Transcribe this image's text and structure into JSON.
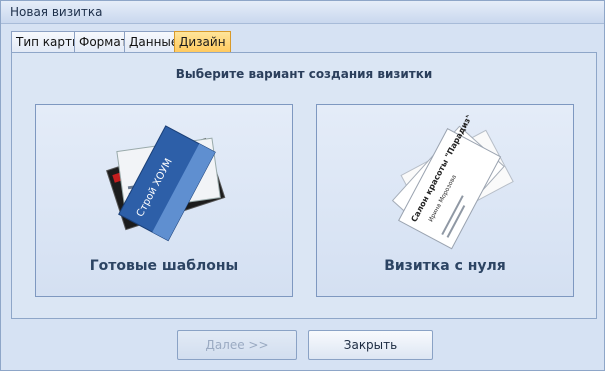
{
  "window": {
    "title": "Новая визитка"
  },
  "tabs": [
    {
      "label": "Тип карты",
      "active": false
    },
    {
      "label": "Формат",
      "active": false
    },
    {
      "label": "Данные",
      "active": false
    },
    {
      "label": "Дизайн",
      "active": true
    }
  ],
  "panel": {
    "heading": "Выберите вариант создания визитки"
  },
  "options": [
    {
      "label": "Готовые шаблоны",
      "card_title": "Строй ХОУМ"
    },
    {
      "label": "Визитка с нуля",
      "card_title": "Салон красоты \"Парадиз\"",
      "card_name": "Ирина Морозова"
    }
  ],
  "buttons": {
    "next": "Далее >>",
    "close": "Закрыть"
  },
  "colors": {
    "active_tab": "#ffc85c",
    "template_card": "#2d5fa8"
  }
}
